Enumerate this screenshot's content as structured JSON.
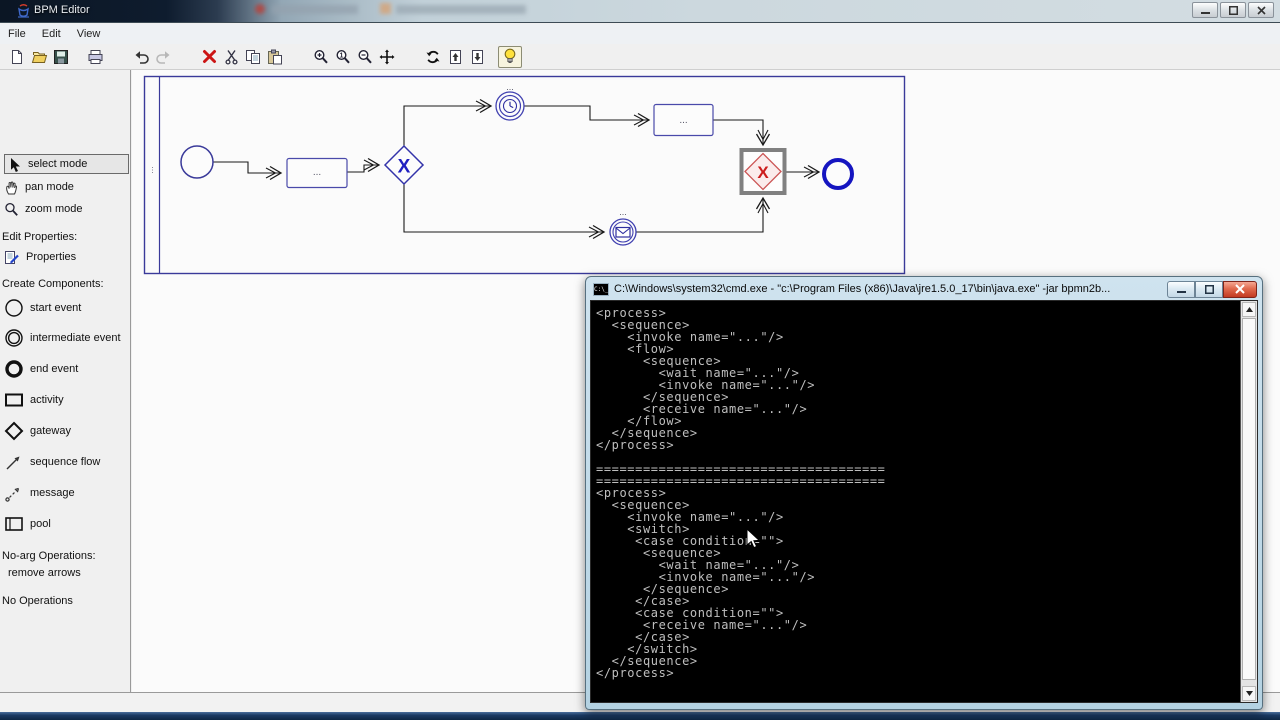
{
  "window": {
    "title": "BPM Editor"
  },
  "menu": {
    "items": [
      "File",
      "Edit",
      "View"
    ]
  },
  "toolbar": {
    "icons": [
      "new",
      "open",
      "save",
      "print",
      "undo",
      "redo",
      "delete",
      "cut",
      "copy",
      "paste",
      "zoom-in",
      "zoom-100",
      "zoom-out",
      "pan",
      "refresh",
      "export",
      "import",
      "help"
    ]
  },
  "sidebar": {
    "modes": [
      {
        "label": "select mode"
      },
      {
        "label": "pan mode"
      },
      {
        "label": "zoom mode"
      }
    ],
    "sections": {
      "edit_properties": "Edit Properties:",
      "properties": "Properties",
      "create_components": "Create Components:",
      "components": [
        "start event",
        "intermediate event",
        "end event",
        "activity",
        "gateway",
        "sequence flow",
        "message",
        "pool"
      ],
      "noarg": "No-arg Operations:",
      "remove_arrows": "remove arrows",
      "no_operations": "No Operations"
    }
  },
  "diagram": {
    "pool_label": "...",
    "nodes": {
      "activity1": "...",
      "activity2": "...",
      "gateway1": "X",
      "gateway2": "X",
      "timer_label": "...",
      "message_label": "..."
    }
  },
  "terminal": {
    "title": "C:\\Windows\\system32\\cmd.exe - \"c:\\Program Files (x86)\\Java\\jre1.5.0_17\\bin\\java.exe\"  -jar bpmn2b...",
    "lines": [
      "<process>",
      "  <sequence>",
      "    <invoke name=\"...\"/>",
      "    <flow>",
      "      <sequence>",
      "        <wait name=\"...\"/>",
      "        <invoke name=\"...\"/>",
      "      </sequence>",
      "      <receive name=\"...\"/>",
      "    </flow>",
      "  </sequence>",
      "</process>",
      "",
      "=====================================",
      "=====================================",
      "<process>",
      "  <sequence>",
      "    <invoke name=\"...\"/>",
      "    <switch>",
      "     <case condition=\"\">",
      "      <sequence>",
      "        <wait name=\"...\"/>",
      "        <invoke name=\"...\"/>",
      "      </sequence>",
      "     </case>",
      "     <case condition=\"\">",
      "      <receive name=\"...\"/>",
      "     </case>",
      "    </switch>",
      "  </sequence>",
      "</process>"
    ]
  },
  "colors": {
    "diagram_blue": "#3a3a9a",
    "bold_blue": "#2020c0",
    "selection_gray": "#808080",
    "selected_red": "#cc2222",
    "console_bg": "#000000",
    "console_fg": "#bfbfbf",
    "taskbar_blue": "#1b3a63"
  }
}
